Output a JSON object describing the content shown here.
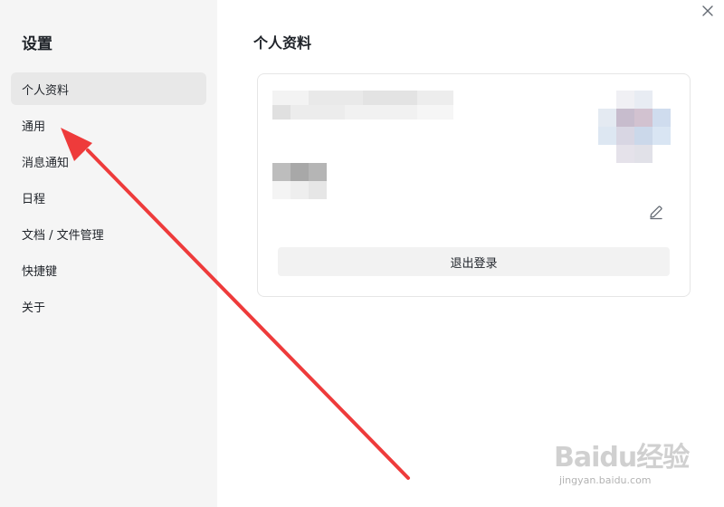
{
  "sidebar": {
    "title": "设置",
    "items": [
      {
        "label": "个人资料",
        "active": true
      },
      {
        "label": "通用"
      },
      {
        "label": "消息通知"
      },
      {
        "label": "日程"
      },
      {
        "label": "文档 / 文件管理"
      },
      {
        "label": "快捷键"
      },
      {
        "label": "关于"
      }
    ]
  },
  "main": {
    "title": "个人资料",
    "profile_card": {
      "logout_label": "退出登录"
    }
  },
  "icons": {
    "close": "close-icon",
    "edit": "pencil-icon"
  },
  "watermark": {
    "logo": "Baidu经验",
    "sub": "jingyan.baidu.com"
  },
  "colors": {
    "sidebar_bg": "#f5f5f5",
    "active_item_bg": "#e8e8e8",
    "annotation_arrow": "#ee3b3b"
  }
}
